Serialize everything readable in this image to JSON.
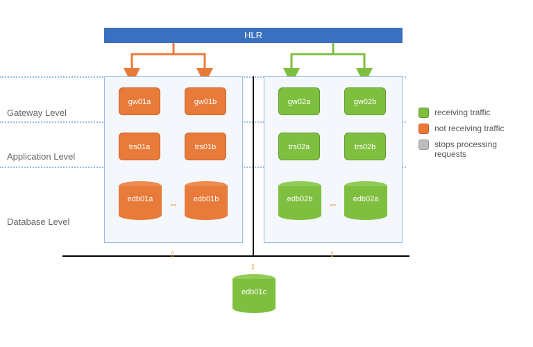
{
  "title": "HLR",
  "labels": {
    "gateway": "Gateway Level",
    "application": "Application Level",
    "database": "Database Level"
  },
  "clusters": {
    "left": {
      "color": "orange",
      "gateway": [
        "gw01a",
        "gw01b"
      ],
      "application": [
        "trs01a",
        "trs01b"
      ],
      "database": [
        "edb01a",
        "edb01b"
      ]
    },
    "right": {
      "color": "green",
      "gateway": [
        "gw02a",
        "gw02b"
      ],
      "application": [
        "trs02a",
        "trs02b"
      ],
      "database": [
        "edb02b",
        "edb02a"
      ]
    }
  },
  "witness": "edb01c",
  "legend": {
    "green": "receiving traffic",
    "orange": "not receiving traffic",
    "gray": "stops processing requests"
  }
}
